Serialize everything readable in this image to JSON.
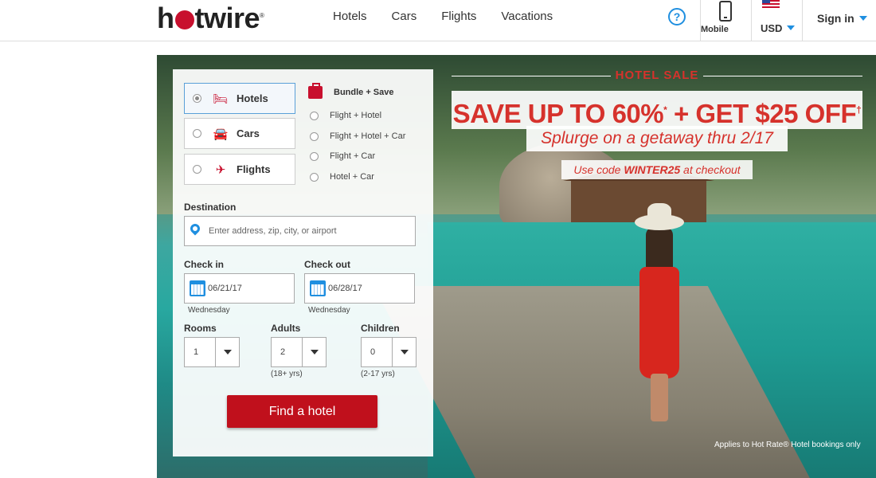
{
  "header": {
    "logo_left": "h",
    "logo_right": "twire",
    "logo_mark": "®",
    "nav": [
      "Hotels",
      "Cars",
      "Flights",
      "Vacations"
    ],
    "help_label": "?",
    "mobile_label": "Mobile",
    "currency_label": "USD",
    "signin_label": "Sign in",
    "colors": {
      "brand": "#c8102e",
      "link": "#1f8fe0"
    }
  },
  "search": {
    "product_tabs": [
      {
        "label": "Hotels",
        "icon": "bed-icon",
        "selected": true
      },
      {
        "label": "Cars",
        "icon": "car-icon",
        "selected": false
      },
      {
        "label": "Flights",
        "icon": "plane-icon",
        "selected": false
      }
    ],
    "bundle_heading": "Bundle + Save",
    "bundle_options": [
      "Flight + Hotel",
      "Flight + Hotel + Car",
      "Flight + Car",
      "Hotel + Car"
    ],
    "destination_label": "Destination",
    "destination_placeholder": "Enter address, zip, city, or airport",
    "checkin_label": "Check in",
    "checkin_value": "06/21/17",
    "checkin_day": "Wednesday",
    "checkout_label": "Check out",
    "checkout_value": "06/28/17",
    "checkout_day": "Wednesday",
    "rooms_label": "Rooms",
    "rooms_value": "1",
    "adults_label": "Adults",
    "adults_value": "2",
    "adults_hint": "(18+ yrs)",
    "children_label": "Children",
    "children_value": "0",
    "children_hint": "(2-17 yrs)",
    "submit_label": "Find a hotel",
    "submit_color": "#c0101c"
  },
  "promo": {
    "label": "HOTEL SALE",
    "headline": "SAVE UP TO 60%",
    "headline_mark_1": "*",
    "headline_2": " + GET $25 OFF",
    "headline_mark_2": "†",
    "subline": "Splurge on a getaway thru 2/17",
    "code_prefix": "Use code ",
    "code": "WINTER25",
    "code_suffix": " at checkout",
    "fine_print": "Applies to Hot Rate® Hotel bookings only"
  }
}
